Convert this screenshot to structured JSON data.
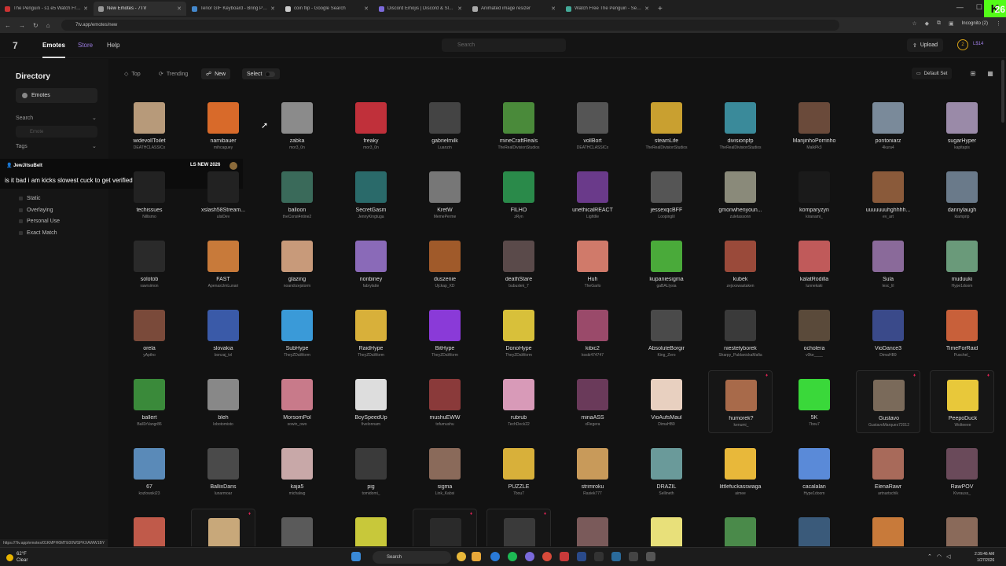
{
  "browser": {
    "tabs": [
      {
        "label": "The Penguin - s1 e5 Watch Fre...",
        "color": "#c33"
      },
      {
        "label": "New Emotes - 7TV",
        "color": "#999",
        "active": true
      },
      {
        "label": "Tenor GIF Keyboard - Bring Pe...",
        "color": "#48c"
      },
      {
        "label": "coin flip - Google Search",
        "color": "#ccc"
      },
      {
        "label": "Discord Emojis | Discord & Sla...",
        "color": "#7c6adb"
      },
      {
        "label": "Animated image resizer",
        "color": "#aaa"
      },
      {
        "label": "Watch Free The Penguin - Seas...",
        "color": "#4a9"
      }
    ],
    "new_tab": "+",
    "url": "7tv.app/emotes/new",
    "incognito": "Incognito (2)",
    "kick_badge": "K",
    "kick_count": "26"
  },
  "header": {
    "logo": "7",
    "nav": {
      "emotes": "Emotes",
      "store": "Store",
      "help": "Help"
    },
    "search_placeholder": "Search",
    "upload": "Upload",
    "avatar_initial": "2",
    "coins": "L$14"
  },
  "sidebar": {
    "title": "Directory",
    "emotes": "Emotes",
    "search_label": "Search",
    "search_placeholder": "Emote",
    "tags_label": "Tags",
    "checks": [
      "Static",
      "Overlaying",
      "Personal Use",
      "Exact Match"
    ]
  },
  "chat": {
    "user": "JewJitsuBelt",
    "badge_text": "LS NEW 2026",
    "message": "is it bad i am kicks slowest cuck to get verified"
  },
  "toolbar": {
    "top": "Top",
    "trending": "Trending",
    "new": "New",
    "select": "Select",
    "default_set": "Default Set"
  },
  "emotes": [
    {
      "name": "widevollToilet",
      "owner": "DEATHCLASSICx",
      "color": "#b79a7a"
    },
    {
      "name": "namibauer",
      "owner": "mihcaguey",
      "color": "#d86a2a"
    },
    {
      "name": "zabka",
      "owner": "mor3_0n",
      "color": "#8b8b8b"
    },
    {
      "name": "freaky",
      "owner": "mor3_0n",
      "color": "#c0303a"
    },
    {
      "name": "gabrielmilk",
      "owner": "Luanzin",
      "color": "#444"
    },
    {
      "name": "mineCraftReals",
      "owner": "TheRealDivisionStudios",
      "color": "#4a8a3a"
    },
    {
      "name": "vollBort",
      "owner": "DEATHCLASSICx",
      "color": "#555"
    },
    {
      "name": "steamLife",
      "owner": "TheRealDivisionStudios",
      "color": "#c9a030"
    },
    {
      "name": "divisionpfp",
      "owner": "TheRealDivisionStudios",
      "color": "#3a8a9a"
    },
    {
      "name": "ManjinhoPorrinho",
      "owner": "MalkPk3",
      "color": "#6a4a3a"
    },
    {
      "name": "pontoniarz",
      "owner": "4kura4",
      "color": "#7a8a9a"
    },
    {
      "name": "sugarHyper",
      "owner": "kapitapis",
      "color": "#9a8aa8"
    },
    {
      "name": "techissues",
      "owner": "Nillismo",
      "color": "#222"
    },
    {
      "name": "xslash58Stream...",
      "owner": "ulsiDev",
      "color": "#222"
    },
    {
      "name": "balloon",
      "owner": "theConst4ntine2",
      "color": "#3a6a5a"
    },
    {
      "name": "SecretGasm",
      "owner": "JennyKingtuga",
      "color": "#2a6a6a"
    },
    {
      "name": "KretW",
      "owner": "MemePerme",
      "color": "#777"
    },
    {
      "name": "FILHO",
      "owner": "zRyn",
      "color": "#2a8a4a"
    },
    {
      "name": "unethicalREACT",
      "owner": "LightIle",
      "color": "#6a3a8a"
    },
    {
      "name": "jessexqcBFF",
      "owner": "Loopinglil",
      "color": "#555"
    },
    {
      "name": "gmonwhenyoun...",
      "owner": "zuletassonn",
      "color": "#8a8a7a"
    },
    {
      "name": "komparyzyn",
      "owner": "kiranami_",
      "color": "#1a1a1a"
    },
    {
      "name": "uuuuuuuhghhhh...",
      "owner": "ev_art",
      "color": "#8a5a3a"
    },
    {
      "name": "dannylaugh",
      "owner": "klamprip",
      "color": "#6a7a8a"
    },
    {
      "name": "solotob",
      "owner": "rawrsimon",
      "color": "#2a2a2a"
    },
    {
      "name": "FAST",
      "owner": "ApenasUmLunari",
      "color": "#c87a3a"
    },
    {
      "name": "glazing",
      "owner": "noandrzejstorm",
      "color": "#c89a7a"
    },
    {
      "name": "nonbiney",
      "owner": "fabrylatte",
      "color": "#8a6ab8"
    },
    {
      "name": "duszenie",
      "owner": "Ujckap_XD",
      "color": "#a05a2a"
    },
    {
      "name": "deathStare",
      "owner": "bubuslek_7",
      "color": "#5a4a4a"
    },
    {
      "name": "Huh",
      "owner": "TheGarlo",
      "color": "#d07a6a"
    },
    {
      "name": "kupaniesigma",
      "owner": "gaBALlysia",
      "color": "#4aaa3a"
    },
    {
      "name": "kubek",
      "owner": "zejxxswastaken",
      "color": "#9a4a3a"
    },
    {
      "name": "kalatRodilla",
      "owner": "lunnekaki",
      "color": "#c05a5a"
    },
    {
      "name": "Sula",
      "owner": "lesc_lil",
      "color": "#8a6a9a"
    },
    {
      "name": "muduuki",
      "owner": "Hype1doom",
      "color": "#6a9a7a"
    },
    {
      "name": "orela",
      "owner": "yAptho",
      "color": "#7a4a3a"
    },
    {
      "name": "slovakia",
      "owner": "bonzaj_tvl",
      "color": "#3a5aa8"
    },
    {
      "name": "SubHype",
      "owner": "TheyZDaWorm",
      "color": "#3a9ad8"
    },
    {
      "name": "RaidHype",
      "owner": "TheyZDaWorm",
      "color": "#d8b03a"
    },
    {
      "name": "BitHype",
      "owner": "TheyZDaWorm",
      "color": "#8a3ad8"
    },
    {
      "name": "DonoHype",
      "owner": "TheyZDaWorm",
      "color": "#d8c03a"
    },
    {
      "name": "kibic2",
      "owner": "koski474747",
      "color": "#9a4a6a"
    },
    {
      "name": "AbsoluteBorgir",
      "owner": "King_Zero",
      "color": "#4a4a4a"
    },
    {
      "name": "niestetyborek",
      "owner": "Sharpy_PablanickaMafia",
      "color": "#3a3a3a"
    },
    {
      "name": "ocholera",
      "owner": "v0ke____",
      "color": "#5a4a3a"
    },
    {
      "name": "VioDance3",
      "owner": "DimaHB9",
      "color": "#3a4a8a"
    },
    {
      "name": "TimeForRaid",
      "owner": "Puschel_",
      "color": "#c8603a"
    },
    {
      "name": "ballert",
      "owner": "Ball3rVangr86",
      "color": "#3a8a3a"
    },
    {
      "name": "bleh",
      "owner": "lobotomisto",
      "color": "#888"
    },
    {
      "name": "MorsomPol",
      "owner": "sowin_owo",
      "color": "#c87a8a"
    },
    {
      "name": "BoySpeedUp",
      "owner": "fivelonnam",
      "color": "#ddd"
    },
    {
      "name": "mushuEWW",
      "owner": "tofumushu",
      "color": "#8a3a3a"
    },
    {
      "name": "rubrub",
      "owner": "TechDeck22",
      "color": "#d89ab8"
    },
    {
      "name": "minaASS",
      "owner": "xRegera",
      "color": "#6a3a5a"
    },
    {
      "name": "VioAufsMaul",
      "owner": "DimaHB9",
      "color": "#e8d0c0"
    },
    {
      "name": "humorek?",
      "owner": "kenumi_",
      "color": "#a86a4a",
      "boxed": true
    },
    {
      "name": "5K",
      "owner": "7bou7",
      "color": "#3ad83a"
    },
    {
      "name": "Gustavo",
      "owner": "GustavoMarques72012",
      "color": "#7a6a5a",
      "boxed": true
    },
    {
      "name": "PeepoDuck",
      "owner": "Wolteeee",
      "color": "#e8c83a",
      "boxed": true
    },
    {
      "name": "67",
      "owner": "kozlowski23",
      "color": "#5a8ab8"
    },
    {
      "name": "BallixDans",
      "owner": "lunarmoar",
      "color": "#4a4a4a"
    },
    {
      "name": "kaja5",
      "owner": "michalwg",
      "color": "#c8a8a8"
    },
    {
      "name": "pig",
      "owner": "tomidomi_",
      "color": "#3a3a3a"
    },
    {
      "name": "sigma",
      "owner": "Link_Kabsi",
      "color": "#8a6a5a"
    },
    {
      "name": "PUZZLE",
      "owner": "7bou7",
      "color": "#d8b03a"
    },
    {
      "name": "strimroku",
      "owner": "Rasiek777",
      "color": "#c89a5a"
    },
    {
      "name": "DRAZIL",
      "owner": "Sellineth",
      "color": "#6a9a9a"
    },
    {
      "name": "littlefuckasswaga",
      "owner": "aimee",
      "color": "#e8b83a"
    },
    {
      "name": "cacalalan",
      "owner": "Hype1doom",
      "color": "#5a8ad8"
    },
    {
      "name": "ElenaRawr",
      "owner": "artnartschik",
      "color": "#a86a5a"
    },
    {
      "name": "RawPOV",
      "owner": "Kivrauss_",
      "color": "#6a4a5a"
    },
    {
      "name": "",
      "owner": "",
      "color": "#c05a4a"
    },
    {
      "name": "",
      "owner": "",
      "color": "#c8a87a",
      "boxed": true
    },
    {
      "name": "",
      "owner": "",
      "color": "#5a5a5a"
    },
    {
      "name": "",
      "owner": "",
      "color": "#c8c83a"
    },
    {
      "name": "",
      "owner": "",
      "color": "#2a2a2a",
      "boxed": true
    },
    {
      "name": "",
      "owner": "",
      "color": "#3a3a3a",
      "boxed": true
    },
    {
      "name": "",
      "owner": "",
      "color": "#7a5a5a"
    },
    {
      "name": "",
      "owner": "",
      "color": "#e8e07a"
    },
    {
      "name": "",
      "owner": "",
      "color": "#4a8a4a"
    },
    {
      "name": "",
      "owner": "",
      "color": "#3a5a7a"
    },
    {
      "name": "",
      "owner": "",
      "color": "#c87a3a"
    },
    {
      "name": "",
      "owner": "",
      "color": "#8a6a5a"
    }
  ],
  "status_url": "https://7tv.app/emotes/01KMPH6MTE00WSPKXAWW1BY",
  "taskbar": {
    "weather_temp": "62°F",
    "weather_desc": "Clear",
    "search": "Search",
    "time": "2:39:46 AM",
    "date": "1/27/2026"
  }
}
